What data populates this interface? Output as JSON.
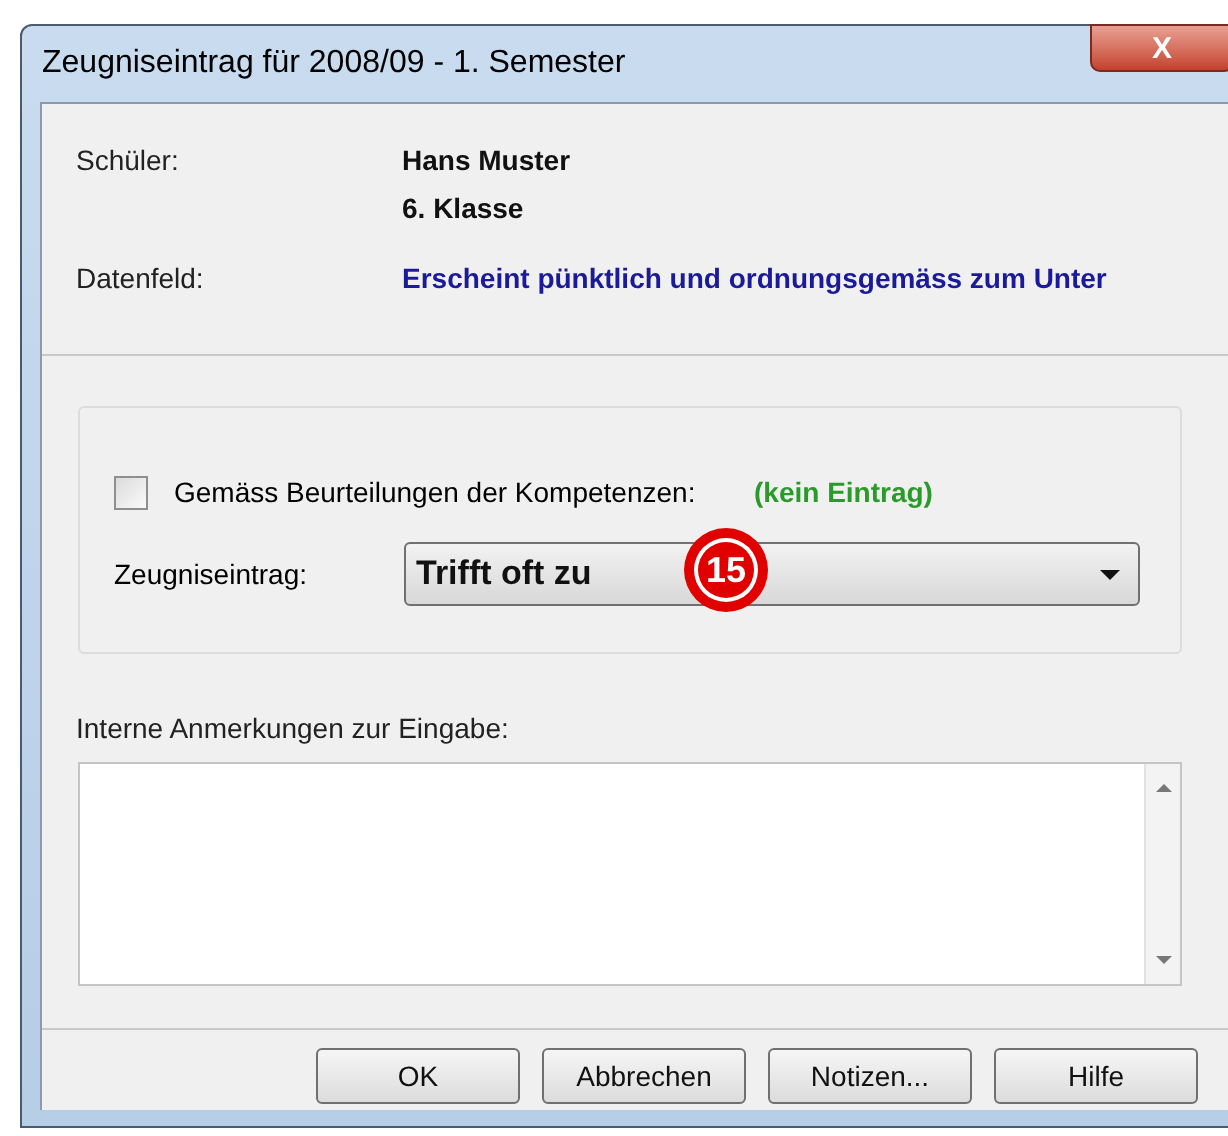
{
  "window": {
    "title": "Zeugniseintrag für 2008/09 - 1. Semester",
    "close": "X"
  },
  "info": [
    {
      "label": "Schüler:",
      "values": [
        "Hans Muster",
        "6. Klasse"
      ],
      "kind": "bold"
    },
    {
      "label": "Datenfeld:",
      "values": [
        "Erscheint pünktlich und ordnungsgemäss zum Unter"
      ],
      "kind": "link"
    }
  ],
  "competence": {
    "label": "Gemäss Beurteilungen der Kompetenzen:",
    "checked": false,
    "status": "(kein Eintrag)"
  },
  "entry": {
    "label": "Zeugniseintrag:",
    "value": "Trifft oft zu",
    "callout": "15"
  },
  "notes": {
    "label": "Interne Anmerkungen zur Eingabe:"
  },
  "buttons": [
    "OK",
    "Abbrechen",
    "Notizen...",
    "Hilfe"
  ]
}
